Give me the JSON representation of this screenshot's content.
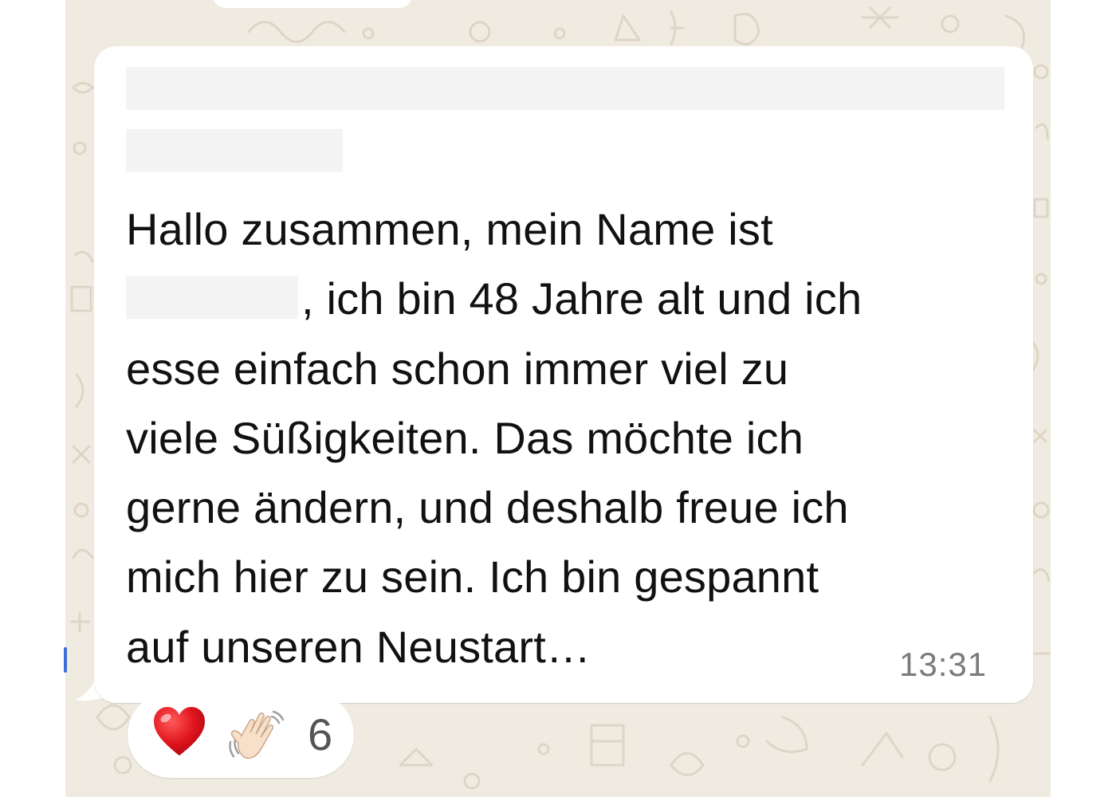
{
  "message": {
    "lines": [
      "Hallo zusammen, mein Name ist",
      ", ich bin 48 Jahre alt und ich",
      "esse einfach schon immer viel zu",
      "viele Süßigkeiten. Das möchte ich",
      "gerne ändern, und deshalb freue ich",
      "mich hier zu sein. Ich bin gespannt",
      "auf unseren Neustart…"
    ],
    "time": "13:31"
  },
  "reactions": {
    "emojis": [
      "heart-icon",
      "waving-hand-icon"
    ],
    "count": "6"
  },
  "colors": {
    "chat_background": "#f0ebe1",
    "bubble": "#ffffff",
    "timestamp": "#7b7b7b",
    "redaction": "#f4f4f4"
  }
}
